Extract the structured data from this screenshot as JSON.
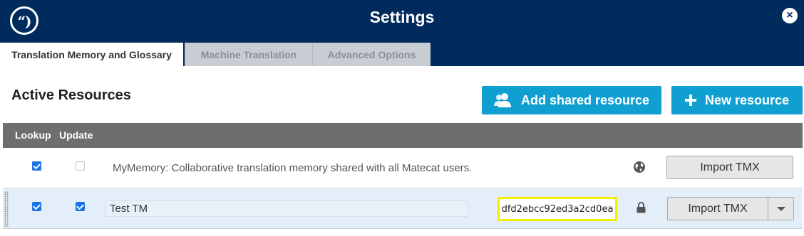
{
  "header": {
    "logo_glyph": "“)",
    "title": "Settings",
    "close_glyph": "×"
  },
  "tabs": [
    {
      "label": "Translation Memory and Glossary",
      "active": true
    },
    {
      "label": "Machine Translation",
      "active": false
    },
    {
      "label": "Advanced Options",
      "active": false
    }
  ],
  "section": {
    "title": "Active Resources"
  },
  "actions": {
    "add_shared_label": "Add shared resource",
    "add_shared_icon": "users-icon",
    "new_resource_label": "New resource",
    "new_resource_icon": "plus-icon"
  },
  "table": {
    "columns": [
      "Lookup",
      "Update"
    ],
    "rows": [
      {
        "lookup": true,
        "update": false,
        "description": "MyMemory: Collaborative translation memory shared with all Matecat users.",
        "visibility_icon": "globe-icon",
        "import_label": "Import TMX"
      },
      {
        "lookup": true,
        "update": true,
        "name": "Test TM",
        "key": "dfd2ebcc92ed3a2cd0ea",
        "visibility_icon": "lock-icon",
        "import_label": "Import TMX"
      }
    ]
  },
  "colors": {
    "header_bg": "#002b5c",
    "accent": "#0f9fd1",
    "key_highlight": "#f4ef00"
  }
}
